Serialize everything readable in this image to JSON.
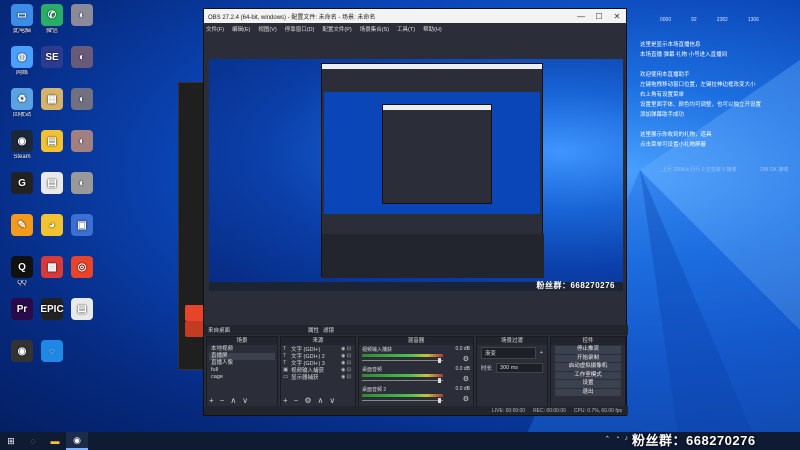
{
  "desktop": {
    "icons": [
      {
        "label": "此电脑",
        "glyph": "▭",
        "color": "#3c8de8"
      },
      {
        "label": "微信",
        "glyph": "✆",
        "color": "#2aae67"
      },
      {
        "label": "",
        "glyph": "◐",
        "color": "#8a8a99"
      },
      {
        "label": "网络",
        "glyph": "◍",
        "color": "#4aa0ff"
      },
      {
        "label": "",
        "glyph": "SE",
        "color": "#2c3b8f"
      },
      {
        "label": "",
        "glyph": "◐",
        "color": "#6a5a7a"
      },
      {
        "label": "回收站",
        "glyph": "♻",
        "color": "#5ba3e0"
      },
      {
        "label": "",
        "glyph": "▦",
        "color": "#d6b36a"
      },
      {
        "label": "",
        "glyph": "◐",
        "color": "#707080"
      },
      {
        "label": "Steam",
        "glyph": "◉",
        "color": "#1b2838"
      },
      {
        "label": "",
        "glyph": "▤",
        "color": "#f1c232"
      },
      {
        "label": "",
        "glyph": "◐",
        "color": "#a08080"
      },
      {
        "label": "",
        "glyph": "G",
        "color": "#222"
      },
      {
        "label": "",
        "glyph": "▤",
        "color": "#e9e9e9"
      },
      {
        "label": "",
        "glyph": "◐",
        "color": "#999"
      },
      {
        "label": "",
        "glyph": "✎",
        "color": "#f29b1d"
      },
      {
        "label": "",
        "glyph": "◕",
        "color": "#f1c232"
      },
      {
        "label": "",
        "glyph": "▣",
        "color": "#3b6fd1"
      },
      {
        "label": "QQ",
        "glyph": "Q",
        "color": "#111"
      },
      {
        "label": "",
        "glyph": "▩",
        "color": "#d83a3a"
      },
      {
        "label": "",
        "glyph": "◎",
        "color": "#e8442a"
      },
      {
        "label": "",
        "glyph": "Pr",
        "color": "#2a0a4a"
      },
      {
        "label": "",
        "glyph": "EPIC",
        "color": "#222"
      },
      {
        "label": "",
        "glyph": "▤",
        "color": "#e9e9e9"
      },
      {
        "label": "",
        "glyph": "◉",
        "color": "#333"
      },
      {
        "label": "",
        "glyph": "◌",
        "color": "#1e88e5"
      }
    ]
  },
  "obs": {
    "title": "OBS 27.2.4 (64-bit, windows) - 配置文件: 未命名 - 场景: 未命名",
    "menu": [
      "文件(F)",
      "编辑(E)",
      "视图(V)",
      "停靠窗口(D)",
      "配置文件(P)",
      "场景集合(S)",
      "工具(T)",
      "帮助(H)"
    ],
    "preview_overlay": "粉丝群：668270276",
    "scene_bar_label": "来自桌面",
    "scene_bar_tabs": [
      "属性",
      "滤镜"
    ],
    "docks": {
      "scenes": {
        "title": "场景",
        "items": [
          "本地视频",
          "直播屏",
          "直播人像",
          "full",
          "cage"
        ],
        "selected": 1
      },
      "sources": {
        "title": "来源",
        "items": [
          {
            "type": "T",
            "name": "文字 (GDI+)"
          },
          {
            "type": "T",
            "name": "文字 (GDI+) 2"
          },
          {
            "type": "T",
            "name": "文字 (GDI+) 3"
          },
          {
            "type": "▣",
            "name": "视频输入捕获"
          },
          {
            "type": "▭",
            "name": "显示器捕获"
          }
        ]
      },
      "mixer": {
        "title": "混音器",
        "channels": [
          {
            "name": "视频输入捕获",
            "db": "0.0 dB"
          },
          {
            "name": "桌面音频",
            "db": "0.0 dB"
          },
          {
            "name": "桌面音频 2",
            "db": "0.0 dB"
          }
        ]
      },
      "transitions": {
        "title": "场景过渡",
        "type": "渐变",
        "duration_label": "时长",
        "duration": "300 ms"
      },
      "controls": {
        "title": "控件",
        "buttons": [
          "停止推流",
          "开始录制",
          "启动虚拟摄像机",
          "工作室模式",
          "设置",
          "退出"
        ]
      }
    },
    "status": {
      "live": "LIVE: 00:00:00",
      "rec": "REC: 00:00:00",
      "cpu": "CPU: 0.7%, 60.00 fps"
    }
  },
  "info_overlay": {
    "stats": [
      "0000",
      "92",
      "2382",
      "1306"
    ],
    "lines": [
      "这里是显示本场直播信息",
      "本场直播  弹幕  礼物  小号进入直播间",
      "",
      "欢迎使用本直播助手",
      "左键拖拽移动窗口位置，左键拉伸边框改变大小",
      "右上角有设置菜单",
      "设置里面字体、颜色均可调整，也可以独立开设置",
      "添加弹幕助手成功",
      "",
      "这里展示你收到的礼物，道具",
      "点击菜单可设置小礼物屏蔽"
    ],
    "net_left": "上行 256K/s 行行 0 正在收 0 接收",
    "net_right": "299 OK 接收"
  },
  "taskbar": {
    "bottom_fan": "粉丝群：668270276",
    "tray": [
      "⌃",
      "◔",
      "♪",
      "中"
    ]
  }
}
